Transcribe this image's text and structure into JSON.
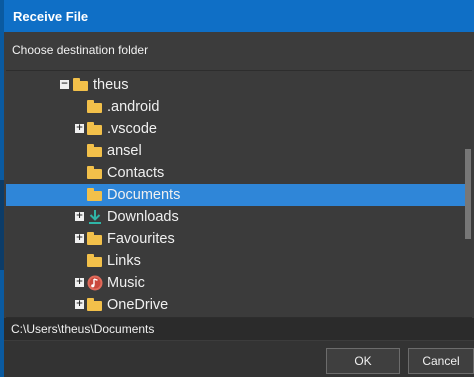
{
  "dialog": {
    "title": "Receive File",
    "prompt": "Choose destination folder",
    "path": "C:\\Users\\theus\\Documents",
    "ok_label": "OK",
    "cancel_label": "Cancel"
  },
  "tree": {
    "items": [
      {
        "label": "theus",
        "icon": "folder-icon",
        "expander": "minus"
      },
      {
        "label": ".android",
        "icon": "folder-icon",
        "expander": "none"
      },
      {
        "label": ".vscode",
        "icon": "folder-icon",
        "expander": "plus"
      },
      {
        "label": "ansel",
        "icon": "folder-icon",
        "expander": "none"
      },
      {
        "label": "Contacts",
        "icon": "folder-icon",
        "expander": "none"
      },
      {
        "label": "Documents",
        "icon": "folder-icon",
        "expander": "none",
        "selected": true
      },
      {
        "label": "Downloads",
        "icon": "download-arrow-icon",
        "expander": "plus"
      },
      {
        "label": "Favourites",
        "icon": "folder-icon",
        "expander": "plus"
      },
      {
        "label": "Links",
        "icon": "folder-icon",
        "expander": "none"
      },
      {
        "label": "Music",
        "icon": "music-icon",
        "expander": "plus"
      },
      {
        "label": "OneDrive",
        "icon": "folder-icon",
        "expander": "plus"
      }
    ]
  },
  "colors": {
    "title_bar": "#0f6fc6",
    "selection": "#2f86d8",
    "folder": "#f2c04a",
    "download": "#2fb5a6",
    "music": "#e06a5a"
  }
}
